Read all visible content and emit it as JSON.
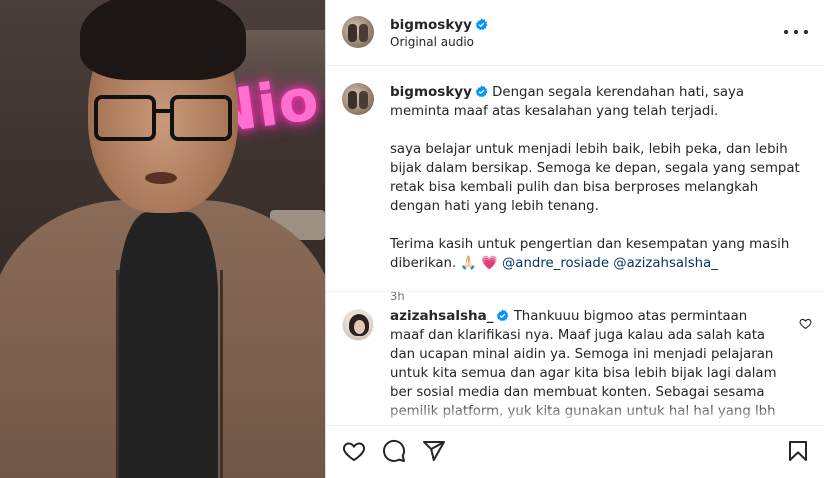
{
  "post": {
    "author": "bigmoskyy",
    "audio_label": "Original audio"
  },
  "video": {
    "neon_text": "Nio"
  },
  "caption": {
    "author": "bigmoskyy",
    "para1": "Dengan segala kerendahan hati, saya meminta maaf atas kesalahan yang telah terjadi.",
    "para2": "saya belajar untuk menjadi lebih baik, lebih peka, dan lebih bijak dalam bersikap. Semoga ke depan, segala yang sempat retak bisa kembali pulih dan bisa berproses melangkah dengan hati yang lebih tenang.",
    "para3_text": "Terima kasih untuk pengertian dan kesempatan yang masih diberikan.",
    "para3_emoji": "🙏🏻 💗",
    "mention1": "@andre_rosiade",
    "mention2": "@azizahsalsha_",
    "time": "3h"
  },
  "comment": {
    "author": "azizahsalsha_",
    "text": "Thankuuu bigmoo atas permintaan maaf dan klarifikasi nya. Maaf juga kalau ada salah kata dan ucapan minal aidin ya. Semoga ini menjadi pelajaran untuk kita semua dan agar kita bisa lebih bijak lagi dalam ber sosial media dan membuat konten. Sebagai sesama pemilik platform, yuk kita gunakan untuk hal hal yang lbh positif dan tdk menjatuhkan orang lain. Semoga hal baik selalu menyertai kita semua 🤍"
  },
  "colors": {
    "verified": "#0095f6",
    "mention": "#00376b",
    "muted": "#737373"
  },
  "icons": [
    "more-icon",
    "verified-icon",
    "heart-icon",
    "comment-icon",
    "share-icon",
    "bookmark-icon"
  ]
}
